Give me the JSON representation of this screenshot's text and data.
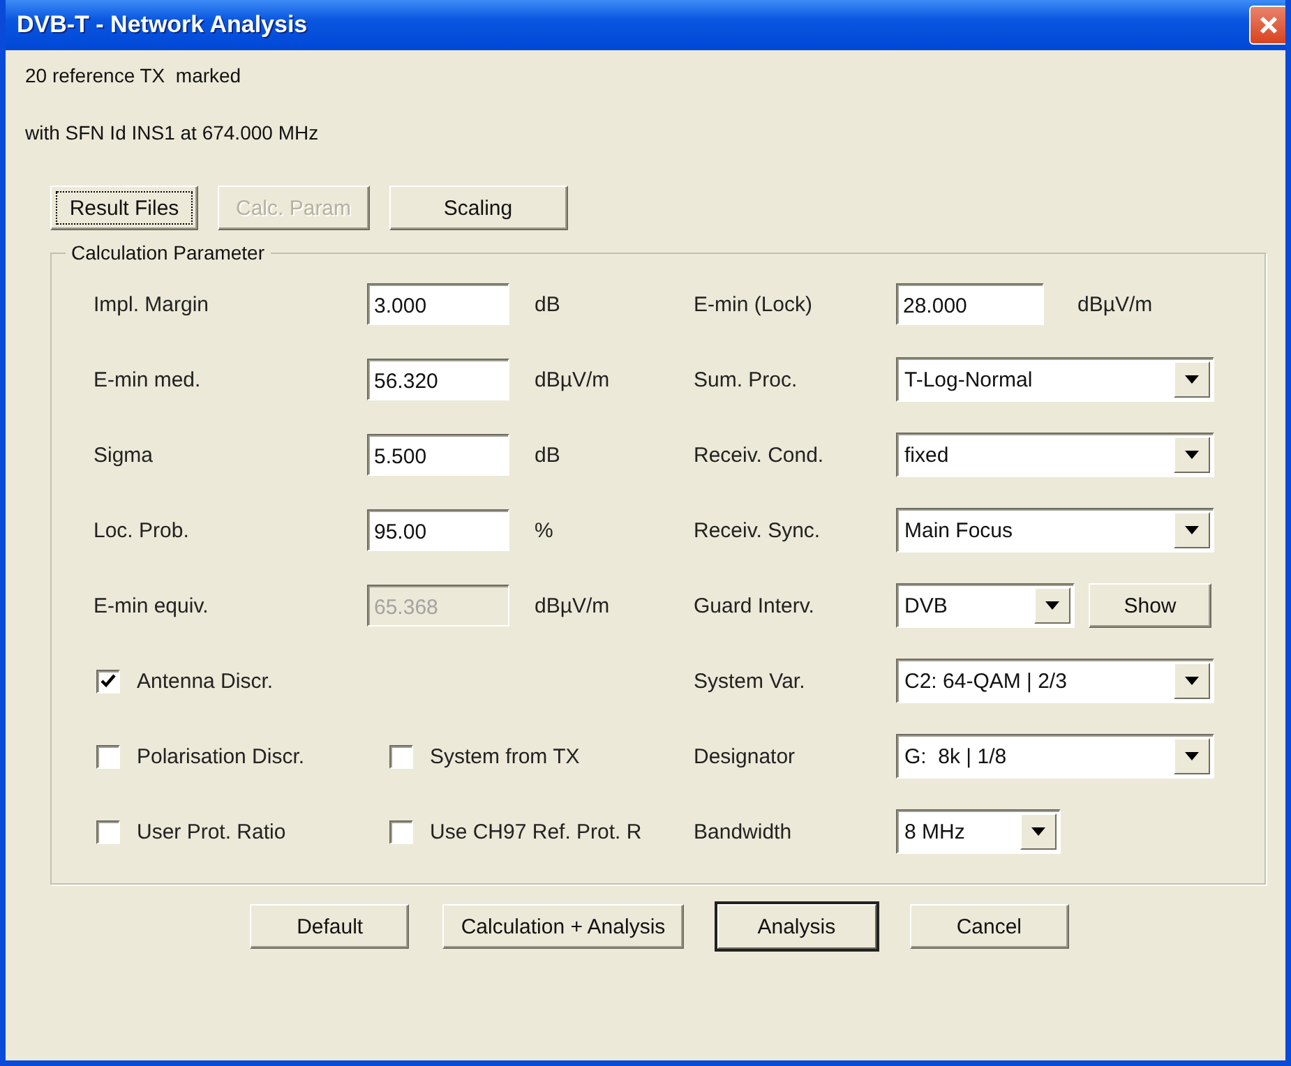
{
  "window": {
    "title": "DVB-T - Network Analysis"
  },
  "info_lines": [
    "20 reference TX  marked",
    "with SFN Id INS1 at 674.000 MHz"
  ],
  "top_buttons": [
    {
      "label": "Result Files",
      "disabled": false,
      "focused": true
    },
    {
      "label": "Calc. Param",
      "disabled": true,
      "focused": false
    },
    {
      "label": "Scaling",
      "disabled": false,
      "focused": false
    }
  ],
  "group": {
    "title": "Calculation Parameter",
    "left_fields": [
      {
        "label": "Impl. Margin",
        "value": "3.000",
        "unit": "dB",
        "disabled": false
      },
      {
        "label": "E-min med.",
        "value": "56.320",
        "unit": "dBµV/m",
        "disabled": false
      },
      {
        "label": "Sigma",
        "value": "5.500",
        "unit": "dB",
        "disabled": false
      },
      {
        "label": "Loc. Prob.",
        "value": "95.00",
        "unit": "%",
        "disabled": false
      },
      {
        "label": "E-min equiv.",
        "value": "65.368",
        "unit": "dBµV/m",
        "disabled": true
      }
    ],
    "checkbox_rows": [
      {
        "items": [
          {
            "label": "Antenna Discr.",
            "checked": true
          }
        ]
      },
      {
        "items": [
          {
            "label": "Polarisation Discr.",
            "checked": false
          },
          {
            "label": "System from TX",
            "checked": false
          }
        ]
      },
      {
        "items": [
          {
            "label": "User Prot. Ratio",
            "checked": false
          },
          {
            "label": "Use CH97 Ref. Prot. R",
            "checked": false
          }
        ]
      }
    ],
    "right_fields": [
      {
        "kind": "field",
        "label": "E-min (Lock)",
        "value": "28.000",
        "unit": "dBµV/m"
      },
      {
        "kind": "select",
        "label": "Sum. Proc.",
        "value": "T-Log-Normal"
      },
      {
        "kind": "select",
        "label": "Receiv. Cond.",
        "value": "fixed"
      },
      {
        "kind": "select",
        "label": "Receiv. Sync.",
        "value": "Main Focus"
      },
      {
        "kind": "select-with-button",
        "label": "Guard Interv.",
        "value": "DVB",
        "button": "Show"
      },
      {
        "kind": "select",
        "label": "System Var.",
        "value": "C2: 64-QAM | 2/3"
      },
      {
        "kind": "select",
        "label": "Designator",
        "value": "G:  8k | 1/8"
      },
      {
        "kind": "short-select",
        "label": "Bandwidth",
        "value": "8 MHz"
      }
    ]
  },
  "bottom_buttons": [
    {
      "label": "Default",
      "default": false
    },
    {
      "label": "Calculation + Analysis",
      "default": false
    },
    {
      "label": "Analysis",
      "default": true
    },
    {
      "label": "Cancel",
      "default": false
    }
  ]
}
